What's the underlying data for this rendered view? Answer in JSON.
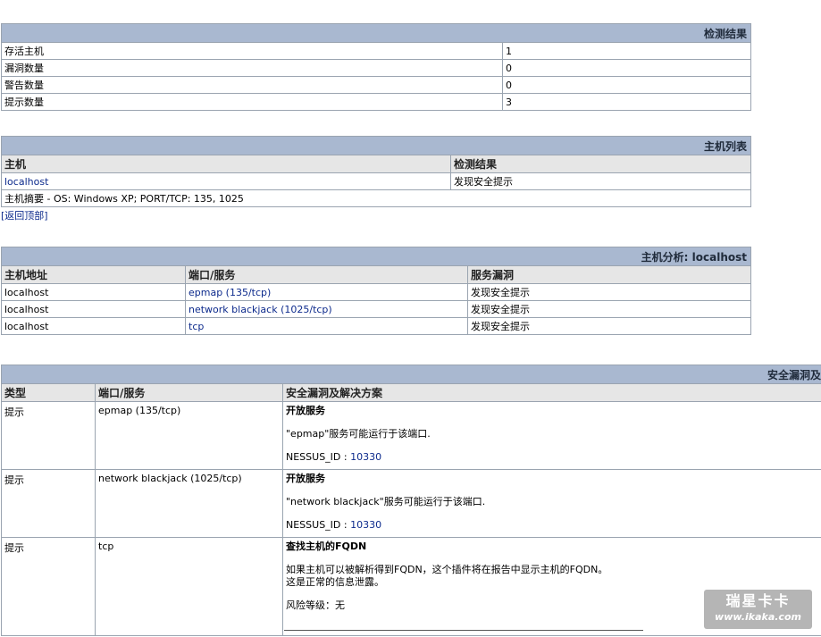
{
  "summary": {
    "title": "检测结果",
    "rows": [
      {
        "label": "存活主机",
        "value": "1"
      },
      {
        "label": "漏洞数量",
        "value": "0"
      },
      {
        "label": "警告数量",
        "value": "0"
      },
      {
        "label": "提示数量",
        "value": "3"
      }
    ]
  },
  "host_list": {
    "title": "主机列表",
    "col_host": "主机",
    "col_result": "检测结果",
    "host": "localhost",
    "result": "发现安全提示",
    "summary_label": "主机摘要",
    "summary_text": " - OS: Windows XP; PORT/TCP: 135, 1025",
    "back_link": "[返回顶部]"
  },
  "host_analysis": {
    "title": "主机分析: localhost",
    "col_addr": "主机地址",
    "col_port": "端口/服务",
    "col_vuln": "服务漏洞",
    "rows": [
      {
        "addr": "localhost",
        "port": "epmap (135/tcp)",
        "vuln": "发现安全提示"
      },
      {
        "addr": "localhost",
        "port": "network blackjack (1025/tcp)",
        "vuln": "发现安全提示"
      },
      {
        "addr": "localhost",
        "port": "tcp",
        "vuln": "发现安全提示"
      }
    ]
  },
  "vuln_details": {
    "title": "安全漏洞及",
    "col_type": "类型",
    "col_port": "端口/服务",
    "col_solution": "安全漏洞及解决方案",
    "rows": [
      {
        "type": "提示",
        "port": "epmap (135/tcp)",
        "name": "开放服务",
        "desc": "\"epmap\"服务可能运行于该端口.",
        "id_label": "NESSUS_ID : ",
        "id": "10330"
      },
      {
        "type": "提示",
        "port": "network blackjack (1025/tcp)",
        "name": "开放服务",
        "desc": "\"network blackjack\"服务可能运行于该端口.",
        "id_label": "NESSUS_ID : ",
        "id": "10330"
      },
      {
        "type": "提示",
        "port": "tcp",
        "name": "查找主机的FQDN",
        "desc": "如果主机可以被解析得到FQDN，这个插件将在报告中显示主机的FQDN。",
        "desc2": "这是正常的信息泄露。",
        "risk": "风险等级：无"
      }
    ]
  },
  "watermark": {
    "line1": "瑞星卡卡",
    "line2": "www.ikaka.com"
  }
}
